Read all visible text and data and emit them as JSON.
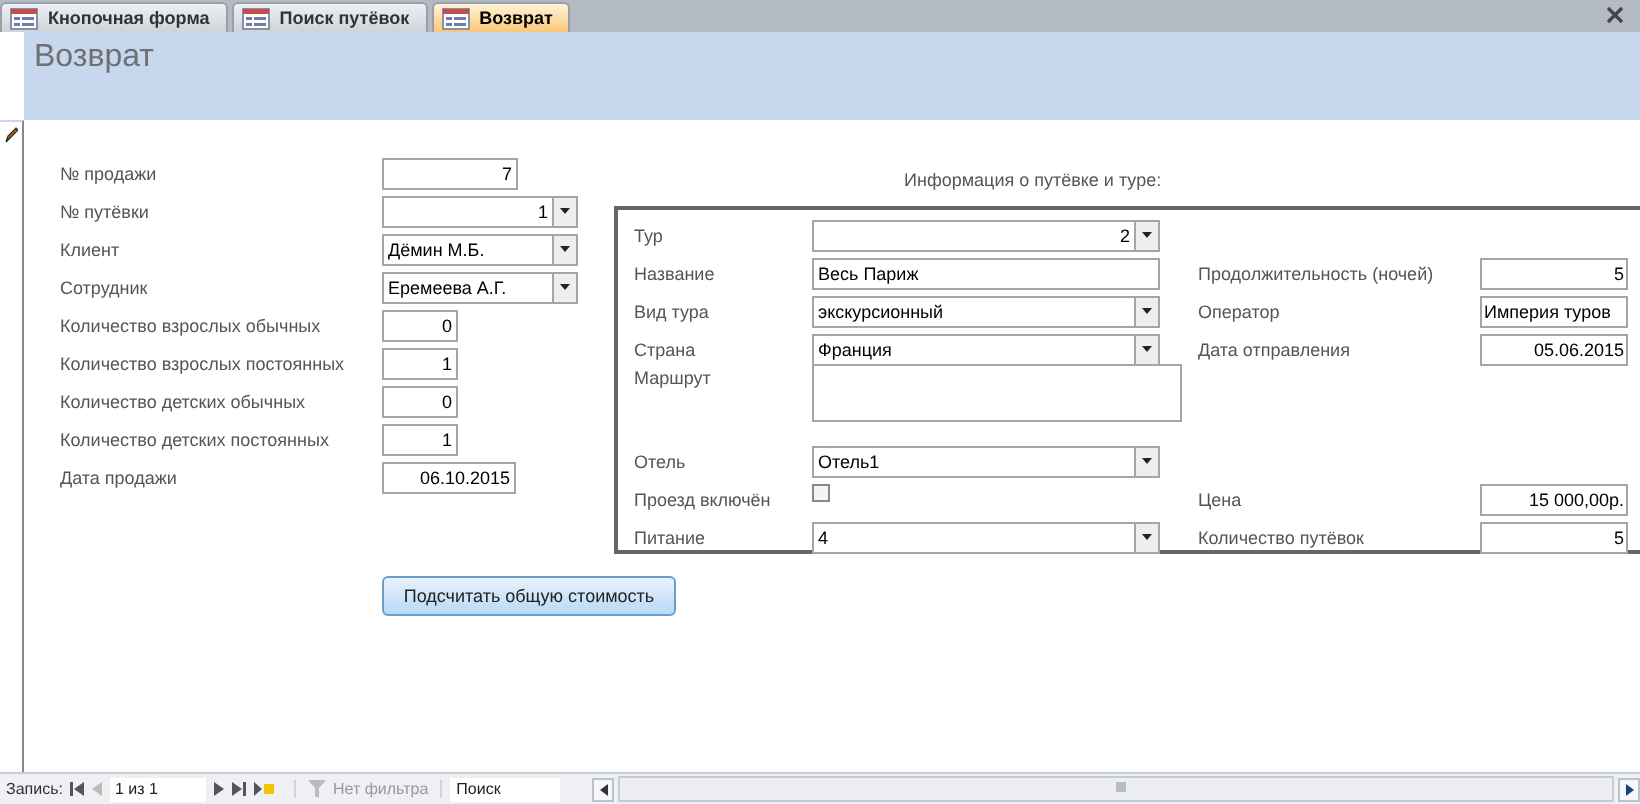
{
  "tabs": [
    {
      "label": "Кнопочная форма",
      "selected": false
    },
    {
      "label": "Поиск путёвок",
      "selected": false
    },
    {
      "label": "Возврат",
      "selected": true
    }
  ],
  "header": {
    "title": "Возврат"
  },
  "sale_fields": [
    {
      "label": "№ продажи",
      "kind": "number",
      "value": "7"
    },
    {
      "label": "№ путёвки",
      "kind": "combo-number",
      "value": "1"
    },
    {
      "label": "Клиент",
      "kind": "combo-text",
      "value": "Дёмин М.Б."
    },
    {
      "label": "Сотрудник",
      "kind": "combo-text",
      "value": "Еремеева А.Г."
    },
    {
      "label": "Количество взрослых обычных",
      "kind": "number",
      "value": "0"
    },
    {
      "label": "Количество взрослых постоянных",
      "kind": "number",
      "value": "1"
    },
    {
      "label": "Количество детских обычных",
      "kind": "number",
      "value": "0"
    },
    {
      "label": "Количество детских постоянных",
      "kind": "number",
      "value": "1"
    },
    {
      "label": "Дата продажи",
      "kind": "number",
      "value": "06.10.2015"
    }
  ],
  "tour_info": {
    "title": "Информация о путёвке и туре:",
    "rows": [
      {
        "left": {
          "label": "Тур",
          "kind": "combo-number",
          "value": "2"
        }
      },
      {
        "left": {
          "label": "Название",
          "kind": "text",
          "value": "Весь Париж"
        },
        "right": {
          "label": "Продолжительность (ночей)",
          "kind": "number",
          "value": "5"
        }
      },
      {
        "left": {
          "label": "Вид тура",
          "kind": "combo-text",
          "value": "экскурсионный"
        },
        "right": {
          "label": "Оператор",
          "kind": "text",
          "value": "Империя туров"
        }
      },
      {
        "left": {
          "label": "Страна",
          "kind": "combo-text",
          "value": "Франция"
        },
        "right": {
          "label": "Дата отправления",
          "kind": "number",
          "value": "05.06.2015"
        }
      },
      {
        "left": {
          "label": "Маршрут",
          "kind": "memo"
        }
      },
      {
        "left": {
          "label": "Отель",
          "kind": "combo-text",
          "value": "Отель1"
        }
      },
      {
        "left": {
          "label": "Проезд включён",
          "kind": "checkbox",
          "checked": false
        },
        "right": {
          "label": "Цена",
          "kind": "number",
          "value": "15 000,00р."
        }
      },
      {
        "left": {
          "label": "Питание",
          "kind": "combo-text",
          "value": "4"
        },
        "right": {
          "label": "Количество путёвок",
          "kind": "number",
          "value": "5"
        }
      }
    ]
  },
  "calc_button": "Подсчитать общую стоимость",
  "status_bar": {
    "record_label": "Запись:",
    "record_position": "1 из 1",
    "filter": "Нет фильтра",
    "search": "Поиск"
  }
}
